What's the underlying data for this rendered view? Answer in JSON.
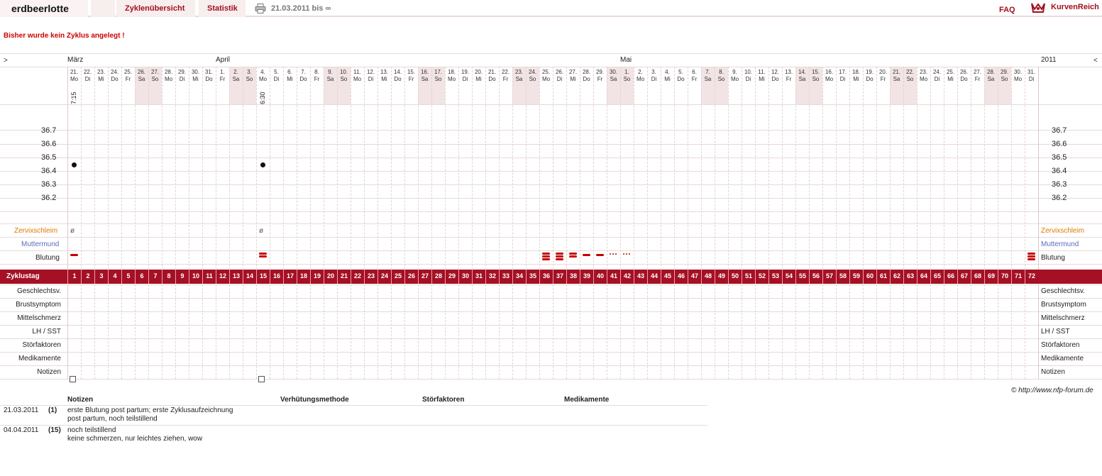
{
  "header": {
    "username": "erdbeerlotte",
    "tabs": [
      "Zyklenübersicht",
      "Statistik"
    ],
    "date_range": "21.03.2011 bis ∞",
    "faq": "FAQ",
    "brand": "KurvenReich"
  },
  "message": "Bisher wurde kein Zyklus angelegt !",
  "chart": {
    "nav_prev": ">",
    "nav_next": "<",
    "year": "2011",
    "months": [
      {
        "label": "März",
        "start_day_index": 0
      },
      {
        "label": "April",
        "start_day_index": 11
      },
      {
        "label": "Mai",
        "start_day_index": 41
      }
    ],
    "days": [
      {
        "d": "21.",
        "w": "Mo"
      },
      {
        "d": "22.",
        "w": "Di"
      },
      {
        "d": "23.",
        "w": "Mi"
      },
      {
        "d": "24.",
        "w": "Do"
      },
      {
        "d": "25.",
        "w": "Fr"
      },
      {
        "d": "26.",
        "w": "Sa"
      },
      {
        "d": "27.",
        "w": "So"
      },
      {
        "d": "28.",
        "w": "Mo"
      },
      {
        "d": "29.",
        "w": "Di"
      },
      {
        "d": "30.",
        "w": "Mi"
      },
      {
        "d": "31.",
        "w": "Do"
      },
      {
        "d": "1.",
        "w": "Fr"
      },
      {
        "d": "2.",
        "w": "Sa"
      },
      {
        "d": "3.",
        "w": "So"
      },
      {
        "d": "4.",
        "w": "Mo"
      },
      {
        "d": "5.",
        "w": "Di"
      },
      {
        "d": "6.",
        "w": "Mi"
      },
      {
        "d": "7.",
        "w": "Do"
      },
      {
        "d": "8.",
        "w": "Fr"
      },
      {
        "d": "9.",
        "w": "Sa"
      },
      {
        "d": "10.",
        "w": "So"
      },
      {
        "d": "11.",
        "w": "Mo"
      },
      {
        "d": "12.",
        "w": "Di"
      },
      {
        "d": "13.",
        "w": "Mi"
      },
      {
        "d": "14.",
        "w": "Do"
      },
      {
        "d": "15.",
        "w": "Fr"
      },
      {
        "d": "16.",
        "w": "Sa"
      },
      {
        "d": "17.",
        "w": "So"
      },
      {
        "d": "18.",
        "w": "Mo"
      },
      {
        "d": "19.",
        "w": "Di"
      },
      {
        "d": "20.",
        "w": "Mi"
      },
      {
        "d": "21.",
        "w": "Do"
      },
      {
        "d": "22.",
        "w": "Fr"
      },
      {
        "d": "23.",
        "w": "Sa"
      },
      {
        "d": "24.",
        "w": "So"
      },
      {
        "d": "25.",
        "w": "Mo"
      },
      {
        "d": "26.",
        "w": "Di"
      },
      {
        "d": "27.",
        "w": "Mi"
      },
      {
        "d": "28.",
        "w": "Do"
      },
      {
        "d": "29.",
        "w": "Fr"
      },
      {
        "d": "30.",
        "w": "Sa"
      },
      {
        "d": "1.",
        "w": "So"
      },
      {
        "d": "2.",
        "w": "Mo"
      },
      {
        "d": "3.",
        "w": "Di"
      },
      {
        "d": "4.",
        "w": "Mi"
      },
      {
        "d": "5.",
        "w": "Do"
      },
      {
        "d": "6.",
        "w": "Fr"
      },
      {
        "d": "7.",
        "w": "Sa"
      },
      {
        "d": "8.",
        "w": "So"
      },
      {
        "d": "9.",
        "w": "Mo"
      },
      {
        "d": "10.",
        "w": "Di"
      },
      {
        "d": "11.",
        "w": "Mi"
      },
      {
        "d": "12.",
        "w": "Do"
      },
      {
        "d": "13.",
        "w": "Fr"
      },
      {
        "d": "14.",
        "w": "Sa"
      },
      {
        "d": "15.",
        "w": "So"
      },
      {
        "d": "16.",
        "w": "Mo"
      },
      {
        "d": "17.",
        "w": "Di"
      },
      {
        "d": "18.",
        "w": "Mi"
      },
      {
        "d": "19.",
        "w": "Do"
      },
      {
        "d": "20.",
        "w": "Fr"
      },
      {
        "d": "21.",
        "w": "Sa"
      },
      {
        "d": "22.",
        "w": "So"
      },
      {
        "d": "23.",
        "w": "Mo"
      },
      {
        "d": "24.",
        "w": "Di"
      },
      {
        "d": "25.",
        "w": "Mi"
      },
      {
        "d": "26.",
        "w": "Do"
      },
      {
        "d": "27.",
        "w": "Fr"
      },
      {
        "d": "28.",
        "w": "Sa"
      },
      {
        "d": "29.",
        "w": "So"
      },
      {
        "d": "30.",
        "w": "Mo"
      },
      {
        "d": "31.",
        "w": "Di"
      }
    ],
    "times": [
      {
        "day_index": 0,
        "time": "7:15"
      },
      {
        "day_index": 14,
        "time": "6:30"
      }
    ],
    "y_ticks": [
      "36.7",
      "36.6",
      "36.5",
      "36.4",
      "36.3",
      "36.2"
    ],
    "temperatures": [
      {
        "day_index": 0,
        "value": 36.45
      },
      {
        "day_index": 14,
        "value": 36.45
      }
    ],
    "rows": {
      "cervix": "Zervixschleim",
      "cervix_color": "#e07800",
      "muttermund": "Muttermund",
      "muttermund_color": "#5c6cc0",
      "bleeding": "Blutung"
    },
    "cervix_marks": [
      {
        "day_index": 0,
        "symbol": "ø"
      },
      {
        "day_index": 14,
        "symbol": "ø"
      }
    ],
    "bleeding": [
      {
        "day_index": 0,
        "level": 1
      },
      {
        "day_index": 14,
        "level": 2
      },
      {
        "day_index": 35,
        "level": 3
      },
      {
        "day_index": 36,
        "level": 3
      },
      {
        "day_index": 37,
        "level": 2
      },
      {
        "day_index": 38,
        "level": 1
      },
      {
        "day_index": 39,
        "level": 1
      },
      {
        "day_index": 40,
        "level": 0.5
      },
      {
        "day_index": 41,
        "level": 0.5
      },
      {
        "day_index": 71,
        "level": 3
      }
    ],
    "cycle_label": "Zyklustag",
    "cycle_color": "#a51024",
    "cycle_days": [
      1,
      2,
      3,
      4,
      5,
      6,
      7,
      8,
      9,
      10,
      11,
      12,
      13,
      14,
      15,
      16,
      17,
      18,
      19,
      20,
      21,
      22,
      23,
      24,
      25,
      26,
      27,
      28,
      29,
      30,
      31,
      32,
      33,
      34,
      35,
      36,
      37,
      38,
      39,
      40,
      41,
      42,
      43,
      44,
      45,
      46,
      47,
      48,
      49,
      50,
      51,
      52,
      53,
      54,
      55,
      56,
      57,
      58,
      59,
      60,
      61,
      62,
      63,
      64,
      65,
      66,
      67,
      68,
      69,
      70,
      71,
      72
    ],
    "lower_rows": [
      "Geschlechtsv.",
      "Brustsymptom",
      "Mittelschmerz",
      "LH / SST",
      "Störfaktoren",
      "Medikamente",
      "Notizen"
    ],
    "note_days": [
      0,
      14
    ],
    "copyright": "© http://www.nfp-forum.de"
  },
  "notes_table": {
    "headers": [
      "Notizen",
      "Verhütungsmethode",
      "Störfaktoren",
      "Medikamente"
    ],
    "rows": [
      {
        "date": "21.03.2011",
        "num": "(1)",
        "lines": [
          "erste Blutung post partum; erste Zyklusaufzeichnung",
          "post partum, noch teilstillend"
        ]
      },
      {
        "date": "04.04.2011",
        "num": "(15)",
        "lines": [
          "noch teilstillend",
          "keine schmerzen, nur leichtes ziehen, wow"
        ]
      }
    ]
  }
}
